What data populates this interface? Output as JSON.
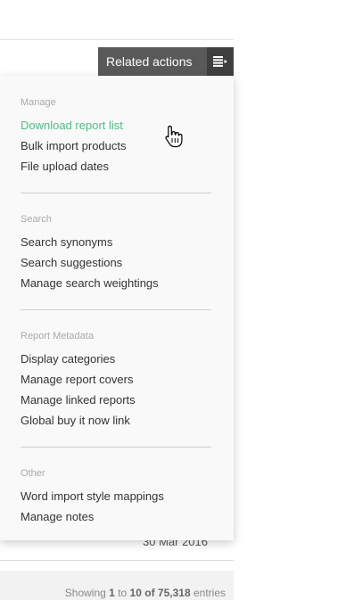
{
  "related_actions": {
    "label": "Related actions",
    "icon": "list-menu-icon"
  },
  "dropdown": {
    "sections": [
      {
        "heading": "Manage",
        "items": [
          "Download report list",
          "Bulk import products",
          "File upload dates"
        ]
      },
      {
        "heading": "Search",
        "items": [
          "Search synonyms",
          "Search suggestions",
          "Manage search weightings"
        ]
      },
      {
        "heading": "Report Metadata",
        "items": [
          "Display categories",
          "Manage report covers",
          "Manage linked reports",
          "Global buy it now link"
        ]
      },
      {
        "heading": "Other",
        "items": [
          "Word import style mappings",
          "Manage notes"
        ]
      }
    ],
    "active_item": "Download report list"
  },
  "table": {
    "partial_date": "30 Mar 2016"
  },
  "pagination": {
    "prefix": "Showing",
    "from": "1",
    "to_word": "to",
    "to": "10",
    "of_word": "of",
    "total": "75,318",
    "suffix": "entries"
  },
  "colors": {
    "button_bg": "#595959",
    "button_icon_bg": "#3f3f3f",
    "active_link": "#4fc082",
    "menu_text": "#333333",
    "section_heading": "#a9a9a9"
  }
}
